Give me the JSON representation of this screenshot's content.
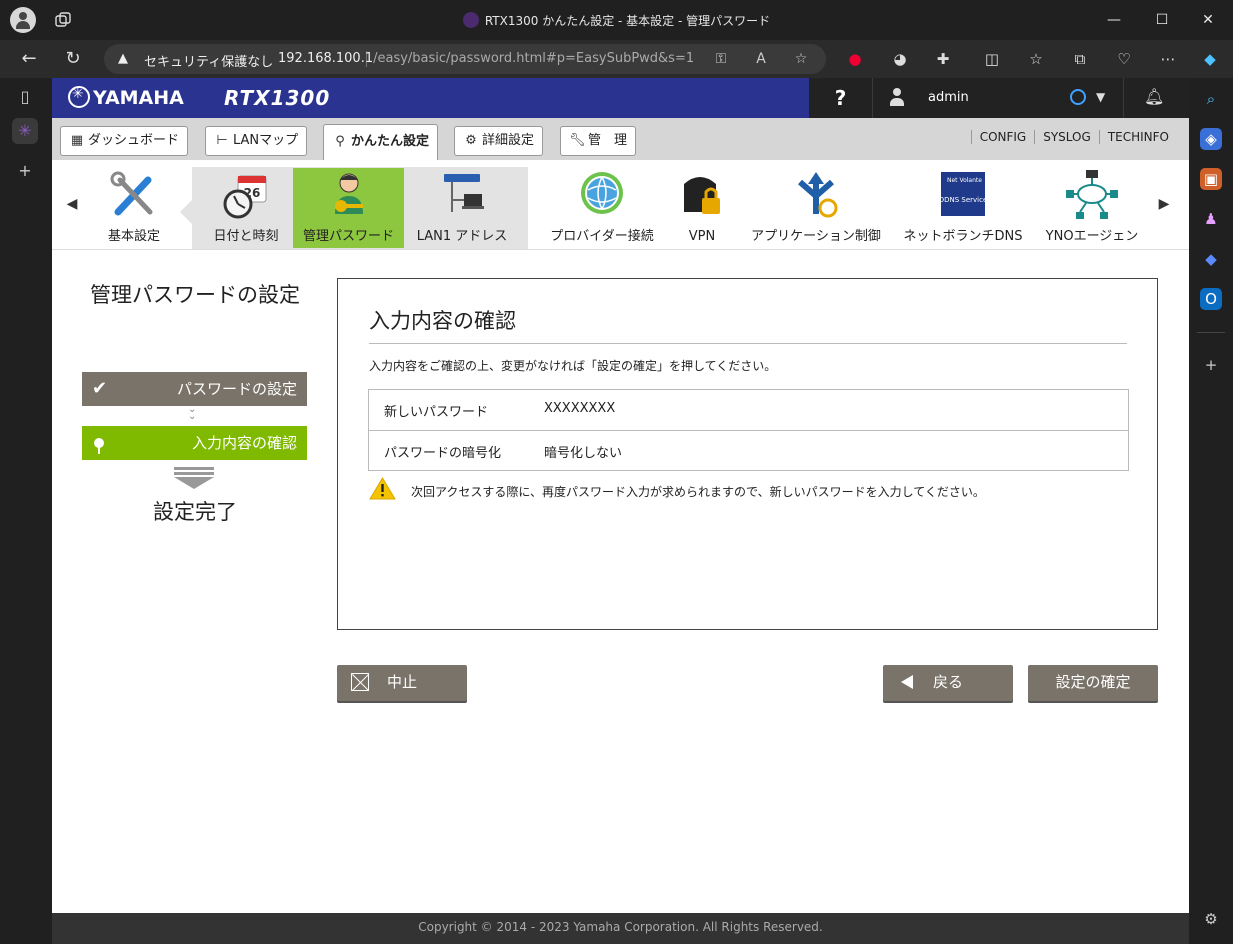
{
  "browser": {
    "tab_title": "RTX1300 かんたん設定 - 基本設定 - 管理パスワード",
    "security_label": "セキュリティ保護なし",
    "url_host": "192.168.100.1",
    "url_path": "/easy/basic/password.html#p=EasySubPwd&s=1"
  },
  "header": {
    "brand": "YAMAHA",
    "model": "RTX1300",
    "help": "?",
    "username": "admin"
  },
  "menu": {
    "tabs": [
      {
        "label": "ダッシュボード"
      },
      {
        "label": "LANマップ"
      },
      {
        "label": "かんたん設定"
      },
      {
        "label": "詳細設定"
      },
      {
        "label": "管　理"
      }
    ],
    "links": [
      "CONFIG",
      "SYSLOG",
      "TECHINFO"
    ]
  },
  "iconbar": {
    "items": [
      {
        "label": "基本設定"
      },
      {
        "label": "日付と時刻"
      },
      {
        "label": "管理パスワード"
      },
      {
        "label": "LAN1 アドレス"
      },
      {
        "label": "プロバイダー接続"
      },
      {
        "label": "VPN"
      },
      {
        "label": "アプリケーション制御"
      },
      {
        "label": "ネットボランチDNS"
      },
      {
        "label": "YNOエージェン"
      }
    ],
    "calendar_day": "26",
    "ddns_text": "DDNS Service",
    "net_text": "Net Volante"
  },
  "steps": {
    "title": "管理パスワードの設定",
    "items": [
      {
        "label": "パスワードの設定"
      },
      {
        "label": "入力内容の確認"
      }
    ],
    "final": "設定完了"
  },
  "panel": {
    "title": "入力内容の確認",
    "description": "入力内容をご確認の上、変更がなければ「設定の確定」を押してください。",
    "rows": [
      {
        "key": "新しいパスワード",
        "value": "XXXXXXXX"
      },
      {
        "key": "パスワードの暗号化",
        "value": "暗号化しない"
      }
    ],
    "warning": "次回アクセスする際に、再度パスワード入力が求められますので、新しいパスワードを入力してください。"
  },
  "buttons": {
    "cancel": "中止",
    "back": "戻る",
    "confirm": "設定の確定"
  },
  "footer": {
    "copyright": "Copyright © 2014 - 2023 Yamaha Corporation. All Rights Reserved."
  },
  "colors": {
    "brand_blue": "#2b3390",
    "active_green": "#8dc63f",
    "step_green": "#7fba00",
    "step_gray": "#7a736a"
  }
}
